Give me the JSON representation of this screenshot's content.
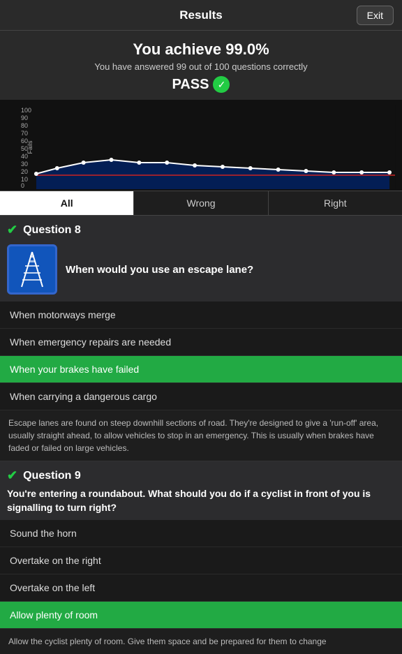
{
  "header": {
    "title": "Results",
    "exit_label": "Exit"
  },
  "score": {
    "headline": "You achieve 99.0%",
    "subtext": "You have answered 99 out of 100 questions correctly",
    "pass_label": "PASS"
  },
  "chart": {
    "y_label": "Fails",
    "y_ticks": [
      "100",
      "90",
      "80",
      "70",
      "60",
      "50",
      "40",
      "30",
      "20",
      "10",
      "0"
    ]
  },
  "tabs": [
    {
      "label": "All",
      "active": true
    },
    {
      "label": "Wrong",
      "active": false
    },
    {
      "label": "Right",
      "active": false
    }
  ],
  "questions": [
    {
      "number": "Question 8",
      "correct": true,
      "text": "When would you use an escape lane?",
      "answers": [
        {
          "text": "When motorways merge",
          "correct": false
        },
        {
          "text": "When emergency repairs are needed",
          "correct": false
        },
        {
          "text": "When your brakes have failed",
          "correct": true
        },
        {
          "text": "When carrying a dangerous cargo",
          "correct": false
        }
      ],
      "explanation": "Escape lanes are found on steep downhill sections of road. They're designed to give a 'run-off' area, usually straight ahead, to allow vehicles to stop in an emergency. This is usually when brakes have faded or failed on large vehicles."
    },
    {
      "number": "Question 9",
      "correct": true,
      "question_line1": "You're entering a roundabout. What should you do if a cyclist in front of you is signalling to turn right?",
      "answers": [
        {
          "text": "Sound the horn",
          "correct": false
        },
        {
          "text": "Overtake on the right",
          "correct": false
        },
        {
          "text": "Overtake on the left",
          "correct": false
        },
        {
          "text": "Allow plenty of room",
          "correct": true
        }
      ],
      "explanation_truncated": "Allow the cyclist plenty of room. Give them space and be prepared for them to change"
    }
  ]
}
